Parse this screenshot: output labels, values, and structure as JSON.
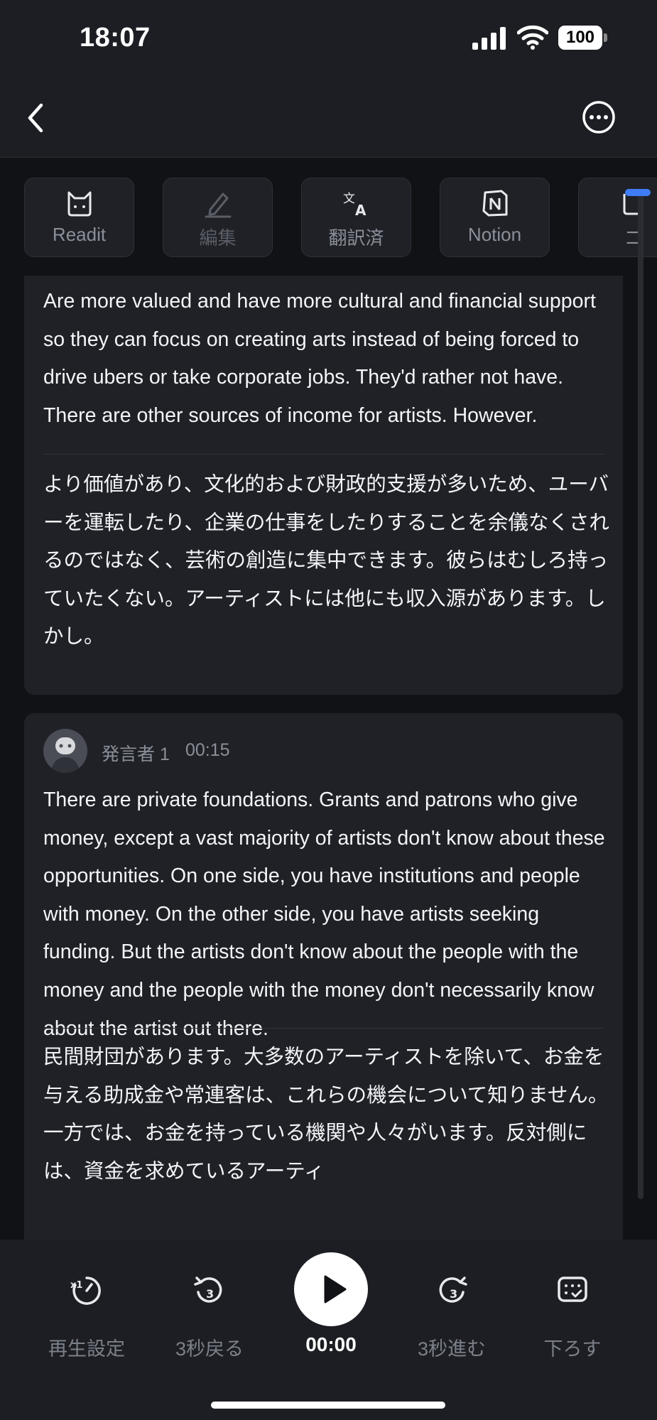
{
  "status_bar": {
    "time": "18:07",
    "battery": "100"
  },
  "toolbar": {
    "items": [
      {
        "label": "Readit",
        "icon": "cat-face-icon"
      },
      {
        "label": "編集",
        "icon": "pencil-icon"
      },
      {
        "label": "翻訳済",
        "icon": "translate-icon"
      },
      {
        "label": "Notion",
        "icon": "notion-icon"
      },
      {
        "label": "コ",
        "icon": "copy-icon"
      }
    ]
  },
  "transcript": {
    "block1": {
      "english": "Are more valued and have more cultural and financial support so they can focus on creating arts instead of being forced to drive ubers or take corporate jobs. They'd rather not have. There are other sources of income for artists. However.",
      "japanese": "より価値があり、文化的および財政的支援が多いため、ユーバーを運転したり、企業の仕事をしたりすることを余儀なくされるのではなく、芸術の創造に集中できます。彼らはむしろ持っていたくない。アーティストには他にも収入源があります。しかし。"
    },
    "block2": {
      "speaker": "発言者 1",
      "timestamp": "00:15",
      "english": "There are private foundations. Grants and patrons who give money, except a vast majority of artists don't know about these opportunities. On one side, you have institutions and people with money. On the other side, you have artists seeking funding. But the artists don't know about the people with the money and the people with the money don't necessarily know about the artist out there.",
      "japanese": "民間財団があります。大多数のアーティストを除いて、お金を与える助成金や常連客は、これらの機会について知りません。一方では、お金を持っている機関や人々がいます。反対側には、資金を求めているアーティ"
    }
  },
  "player": {
    "speed_label": "再生設定",
    "back_label": "3秒戻る",
    "current_time": "00:00",
    "forward_label": "3秒進む",
    "lower_label": "下ろす",
    "skip_seconds": "3"
  },
  "colors": {
    "accent": "#3f7df6",
    "background": "#1c1e23",
    "card": "#1f2127"
  }
}
